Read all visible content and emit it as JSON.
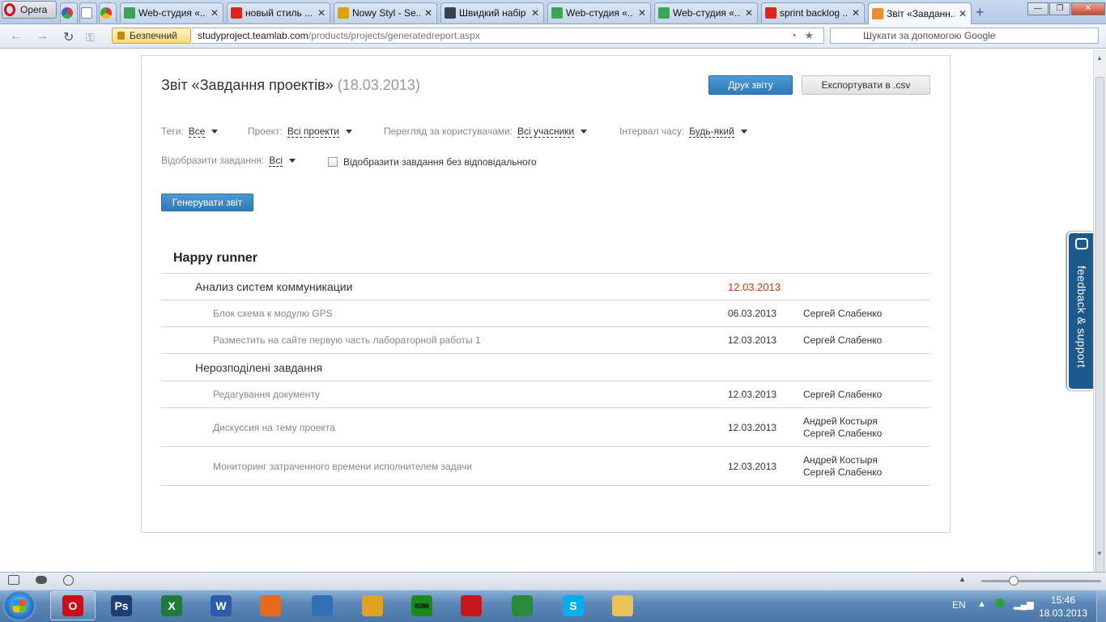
{
  "browser": {
    "menu_label": "Opera",
    "tabs": [
      {
        "title": "Web-студия «...",
        "fav": "#3aa655"
      },
      {
        "title": "новый стиль ...",
        "fav": "#e2231a"
      },
      {
        "title": "Nowy Styl - Se...",
        "fav": "#d8a400"
      },
      {
        "title": "Швидкий набір",
        "fav": "#37414f"
      },
      {
        "title": "Web-студия «...",
        "fav": "#3aa655"
      },
      {
        "title": "Web-студия «...",
        "fav": "#3aa655"
      },
      {
        "title": "sprint backlog ...",
        "fav": "#e2231a"
      },
      {
        "title": "Звіт «Завданн...",
        "fav": "#f28c28"
      }
    ],
    "security_label": "Безпечний",
    "url_host": "studyproject.teamlab.com",
    "url_path": "/products/projects/generatedreport.aspx",
    "search_placeholder": "Шукати за допомогою Google"
  },
  "report": {
    "title": "Звіт «Завдання проектів»",
    "date": "(18.03.2013)",
    "print_button": "Друк звіту",
    "export_button": "Експортувати в .csv",
    "filters": {
      "tags_label": "Теги:",
      "tags_value": "Все",
      "project_label": "Проект:",
      "project_value": "Всі проекти",
      "users_label": "Перегляд за користувачами:",
      "users_value": "Всі учасники",
      "interval_label": "Інтервал часу:",
      "interval_value": "Будь-який",
      "show_tasks_label": "Відобразити завдання:",
      "show_tasks_value": "Всі",
      "unassigned_label": "Відобразити завдання без відповідального"
    },
    "generate_button": "Генерувати звіт",
    "project_name": "Happy runner",
    "rows": [
      {
        "kind": "milestone",
        "name": "Анализ систем коммуникации",
        "due": "12.03.2013",
        "people": []
      },
      {
        "kind": "task",
        "name": "Блок схема к модулю GPS",
        "due": "06.03.2013",
        "people": [
          "Сергей Слабенко"
        ]
      },
      {
        "kind": "task",
        "name": "Разместить на сайте первую часть лабораторной работы 1",
        "due": "12.03.2013",
        "people": [
          "Сергей Слабенко"
        ]
      },
      {
        "kind": "milestone",
        "name": "Нерозподілені завдання",
        "due": "",
        "people": []
      },
      {
        "kind": "task",
        "name": "Редагування документу",
        "due": "12.03.2013",
        "people": [
          "Сергей Слабенко"
        ]
      },
      {
        "kind": "task",
        "name": "Дискуссия на тему проекта",
        "due": "12.03.2013",
        "people": [
          "Андрей Костыря",
          "Сергей Слабенко"
        ]
      },
      {
        "kind": "task",
        "name": "Мониторинг затраченного времени исполнителем задачи",
        "due": "12.03.2013",
        "people": [
          "Андрей Костыря",
          "Сергей Слабенко"
        ]
      }
    ],
    "overdue_color": "#d03b0f"
  },
  "feedback_tab": "feedback & support",
  "taskbar": {
    "apps": [
      {
        "name": "opera-app",
        "label": "O",
        "color": "#cc0f16",
        "pinned": true
      },
      {
        "name": "photoshop-app",
        "label": "Ps",
        "color": "#1d3f73",
        "pinned": false
      },
      {
        "name": "excel-app",
        "label": "X",
        "color": "#1e7b3c",
        "pinned": false
      },
      {
        "name": "word-app",
        "label": "W",
        "color": "#2a5caa",
        "pinned": false
      },
      {
        "name": "firefox-app",
        "label": "",
        "color": "#e66a19",
        "pinned": false
      },
      {
        "name": "qip-app",
        "label": "",
        "color": "#2f6fb5",
        "pinned": false
      },
      {
        "name": "winamp-app",
        "label": "",
        "color": "#e0a020",
        "pinned": false
      },
      {
        "name": "emulator-app",
        "label": "8086",
        "color": "#1a8a1a",
        "pinned": false
      },
      {
        "name": "acrobat-app",
        "label": "",
        "color": "#c8161d",
        "pinned": false
      },
      {
        "name": "chrome-app",
        "label": "",
        "color": "#2a8a3a",
        "pinned": false
      },
      {
        "name": "skype-app",
        "label": "S",
        "color": "#00aff0",
        "pinned": false
      },
      {
        "name": "explorer-app",
        "label": "",
        "color": "#e8c25a",
        "pinned": false
      }
    ],
    "lang": "EN",
    "time": "15:46",
    "date": "18.03.2013"
  }
}
